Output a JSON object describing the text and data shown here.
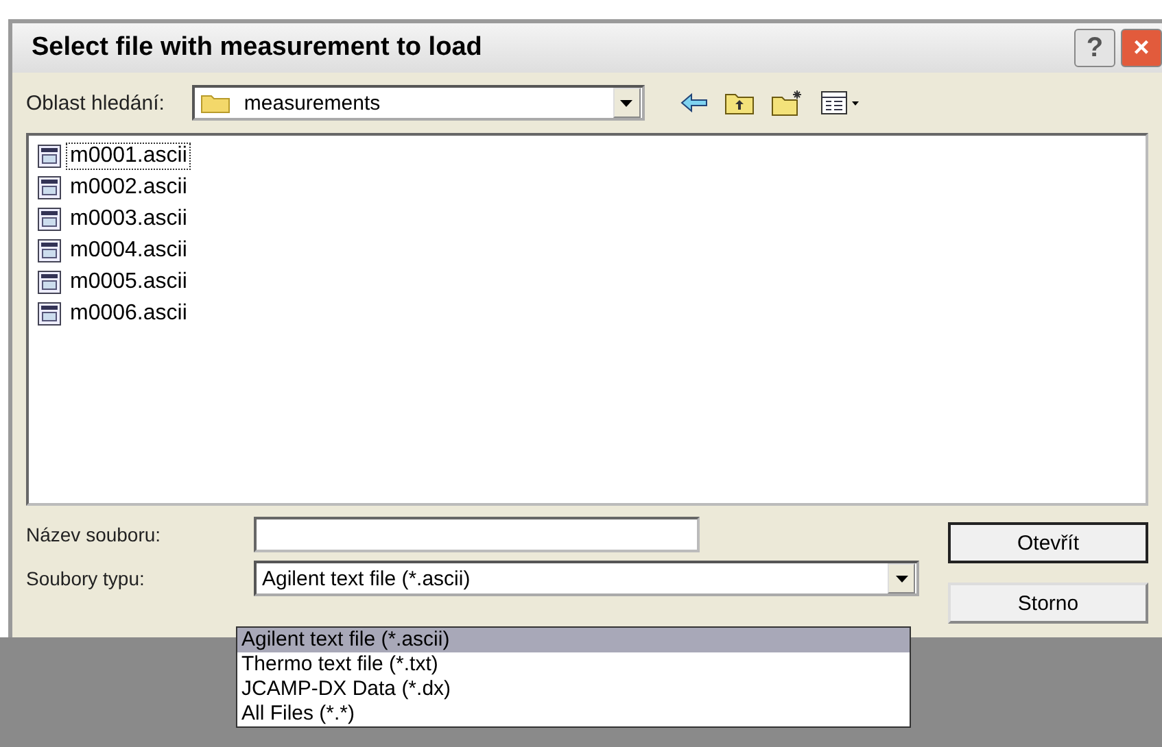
{
  "window": {
    "title": "Select file with measurement to load",
    "help": "?",
    "close": "×"
  },
  "look_in": {
    "label": "Oblast hledání:",
    "value": "measurements"
  },
  "files": [
    {
      "name": "m0001.ascii",
      "focused": true
    },
    {
      "name": "m0002.ascii",
      "focused": false
    },
    {
      "name": "m0003.ascii",
      "focused": false
    },
    {
      "name": "m0004.ascii",
      "focused": false
    },
    {
      "name": "m0005.ascii",
      "focused": false
    },
    {
      "name": "m0006.ascii",
      "focused": false
    }
  ],
  "file_name": {
    "label": "Název souboru:"
  },
  "file_type": {
    "label": "Soubory typu:",
    "value": "Agilent text file (*.ascii)"
  },
  "buttons": [
    "Otevřít",
    "Storno"
  ],
  "type_options": [
    {
      "label": "Agilent text file (*.ascii)",
      "selected": true
    },
    {
      "label": "Thermo text file (*.txt)",
      "selected": false
    },
    {
      "label": "JCAMP-DX Data (*.dx)",
      "selected": false
    },
    {
      "label": "All Files (*.*)",
      "selected": false
    }
  ]
}
